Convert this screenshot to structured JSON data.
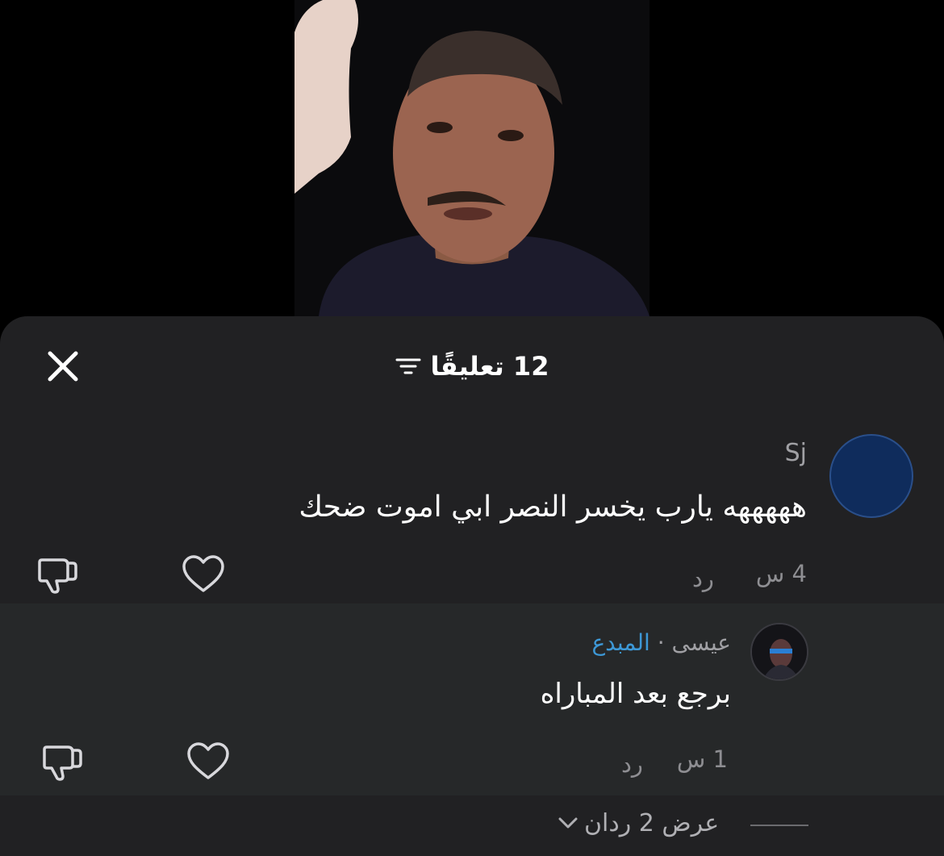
{
  "header": {
    "title": "12 تعليقًا",
    "close_icon": "close-icon",
    "filter_icon": "sort-filter-icon"
  },
  "comments": [
    {
      "username": "Sj",
      "text": "هههههه يارب يخسر النصر ابي اموت ضحك",
      "time": "4 س",
      "reply_label": "رد",
      "avatar_color": "#0f2c5c"
    }
  ],
  "reply": {
    "username": "عيسى",
    "separator": "·",
    "badge": "المبدع",
    "text": "برجع بعد المباراه",
    "time": "1 س",
    "reply_label": "رد"
  },
  "more_replies": {
    "label": "عرض 2 ردان"
  },
  "colors": {
    "sheet_bg": "#212123",
    "reply_bg": "#262829",
    "creator_badge": "#3d98d6"
  }
}
